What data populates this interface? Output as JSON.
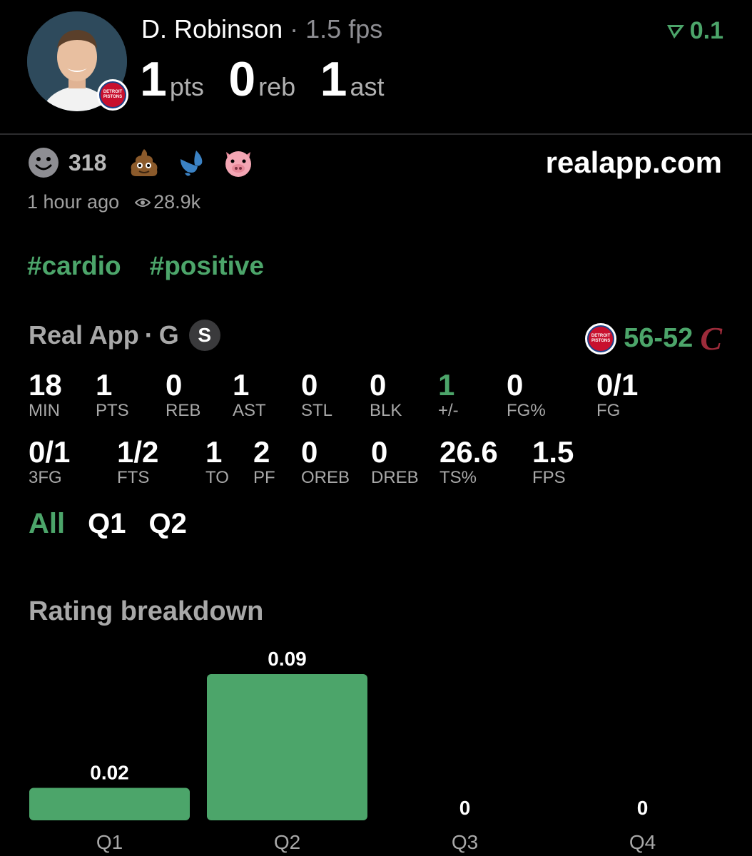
{
  "player": {
    "name": "D. Robinson",
    "separator": "·",
    "fps_label": "1.5 fps",
    "rating": "0.1",
    "team_badge_lines": [
      "DETROIT",
      "PISTONS"
    ]
  },
  "headline_stats": [
    {
      "value": "1",
      "unit": "pts"
    },
    {
      "value": "0",
      "unit": "reb"
    },
    {
      "value": "1",
      "unit": "ast"
    }
  ],
  "reactions": {
    "count": "318",
    "emojis": [
      "smiley-face-icon",
      "poop-emoji-icon",
      "sweat-droplets-emoji-icon",
      "pig-face-emoji-icon"
    ]
  },
  "site": "realapp.com",
  "meta": {
    "time_ago": "1 hour ago",
    "views": "28.9k"
  },
  "tags": [
    "#cardio",
    "#positive"
  ],
  "game": {
    "source": "Real App",
    "separator": "·",
    "position": "G",
    "badge": "S",
    "home_score": "56",
    "dash": "-",
    "away_score": "52",
    "away_logo_glyph": "C"
  },
  "box_score_row1": [
    {
      "value": "18",
      "label": "MIN"
    },
    {
      "value": "1",
      "label": "PTS"
    },
    {
      "value": "0",
      "label": "REB"
    },
    {
      "value": "1",
      "label": "AST"
    },
    {
      "value": "0",
      "label": "STL"
    },
    {
      "value": "0",
      "label": "BLK"
    },
    {
      "value": "1",
      "label": "+/-",
      "highlight": true
    },
    {
      "value": "0",
      "label": "FG%"
    },
    {
      "value": "0/1",
      "label": "FG"
    }
  ],
  "box_score_row2": [
    {
      "value": "0/1",
      "label": "3FG"
    },
    {
      "value": "1/2",
      "label": "FTS"
    },
    {
      "value": "1",
      "label": "TO"
    },
    {
      "value": "2",
      "label": "PF"
    },
    {
      "value": "0",
      "label": "OREB"
    },
    {
      "value": "0",
      "label": "DREB"
    },
    {
      "value": "26.6",
      "label": "TS%"
    },
    {
      "value": "1.5",
      "label": "FPS"
    }
  ],
  "period_tabs": [
    {
      "label": "All",
      "active": true
    },
    {
      "label": "Q1",
      "active": false
    },
    {
      "label": "Q2",
      "active": false
    }
  ],
  "section_title": "Rating breakdown",
  "colors": {
    "accent_green": "#4ca56a",
    "muted_text": "#a8a8a8",
    "background": "#000000"
  },
  "chart_data": {
    "type": "bar",
    "categories": [
      "Q1",
      "Q2",
      "Q3",
      "Q4"
    ],
    "values": [
      0.02,
      0.09,
      0,
      0
    ],
    "data_labels": [
      "0.02",
      "0.09",
      "0",
      "0"
    ],
    "title": "Rating breakdown",
    "xlabel": "",
    "ylabel": "",
    "ylim": [
      0,
      0.09
    ],
    "grid": false,
    "bar_color": "#4ca56a"
  }
}
